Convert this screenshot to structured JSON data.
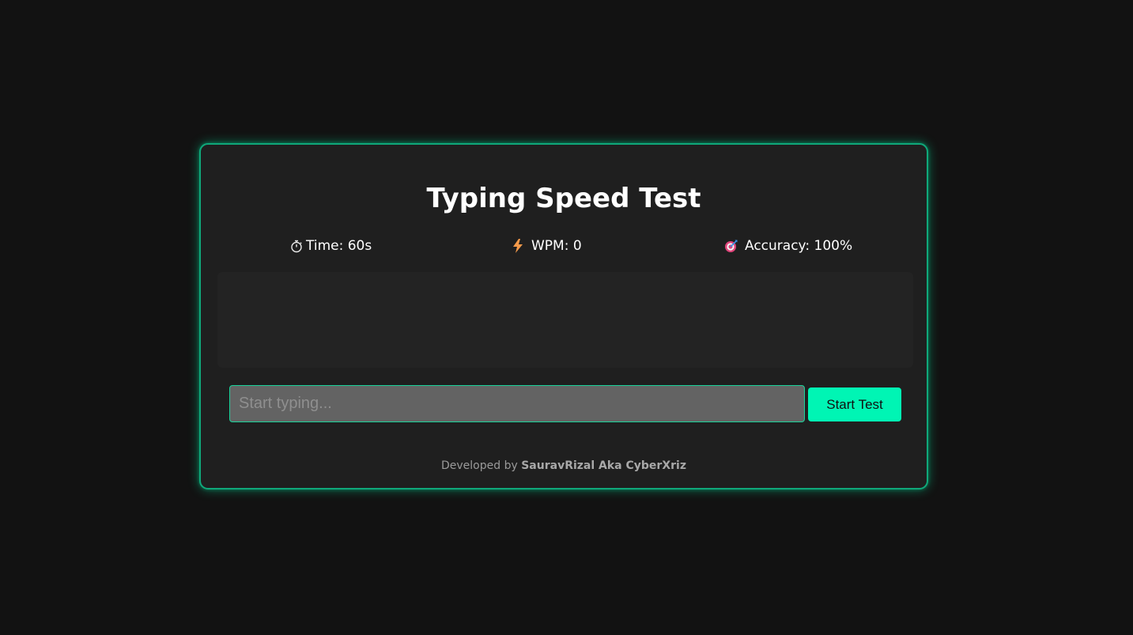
{
  "app": {
    "title": "Typing Speed Test"
  },
  "stats": {
    "time_label": "Time: 60s",
    "wpm_label": "WPM: 0",
    "accuracy_label": "Accuracy: 100%",
    "time_icon": "stopwatch-icon",
    "wpm_icon": "lightning-icon",
    "accuracy_icon": "target-icon"
  },
  "text_display": {
    "content": ""
  },
  "input": {
    "value": "",
    "placeholder": "Start typing..."
  },
  "button": {
    "start_label": "Start Test"
  },
  "footer": {
    "prefix": "Developed by",
    "author": "SauravRizal Aka CyberXriz"
  },
  "colors": {
    "background": "#121212",
    "card": "#1f1f1f",
    "accent": "#00f5b4",
    "border_glow": "#0fa87a",
    "input_bg": "#636363"
  }
}
